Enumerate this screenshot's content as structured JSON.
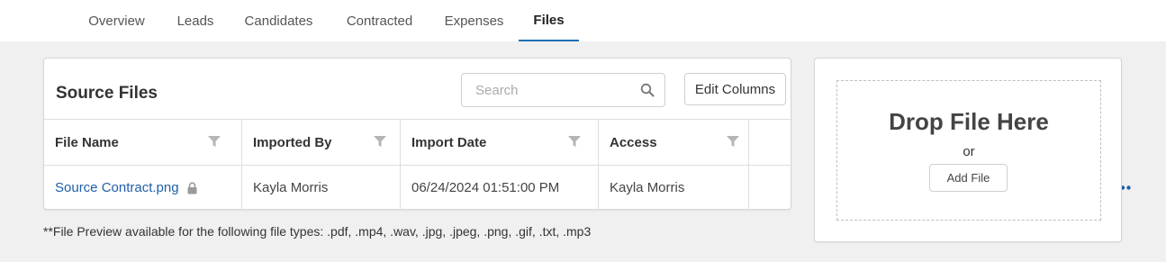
{
  "tabs": [
    {
      "label": "Overview",
      "active": false
    },
    {
      "label": "Leads",
      "active": false
    },
    {
      "label": "Candidates",
      "active": false
    },
    {
      "label": "Contracted",
      "active": false
    },
    {
      "label": "Expenses",
      "active": false
    },
    {
      "label": "Files",
      "active": true
    }
  ],
  "source_files": {
    "title": "Source Files",
    "search_placeholder": "Search",
    "edit_columns_label": "Edit Columns",
    "columns": [
      "File Name",
      "Imported By",
      "Import Date",
      "Access"
    ],
    "rows": [
      {
        "file_name": "Source Contract.png",
        "imported_by": "Kayla Morris",
        "import_date": "06/24/2024 01:51:00 PM",
        "access": "Kayla Morris",
        "actions_icon": "more-horizontal-icon"
      }
    ]
  },
  "footnote": "**File Preview available for the following file types: .pdf, .mp4, .wav, .jpg, .jpeg, .png, .gif, .txt, .mp3",
  "dropzone": {
    "title": "Drop File Here",
    "or_text": "or",
    "add_file_label": "Add File"
  },
  "colors": {
    "accent": "#1f6fb8",
    "link": "#1f5fa8",
    "background": "#f0f0f0"
  }
}
